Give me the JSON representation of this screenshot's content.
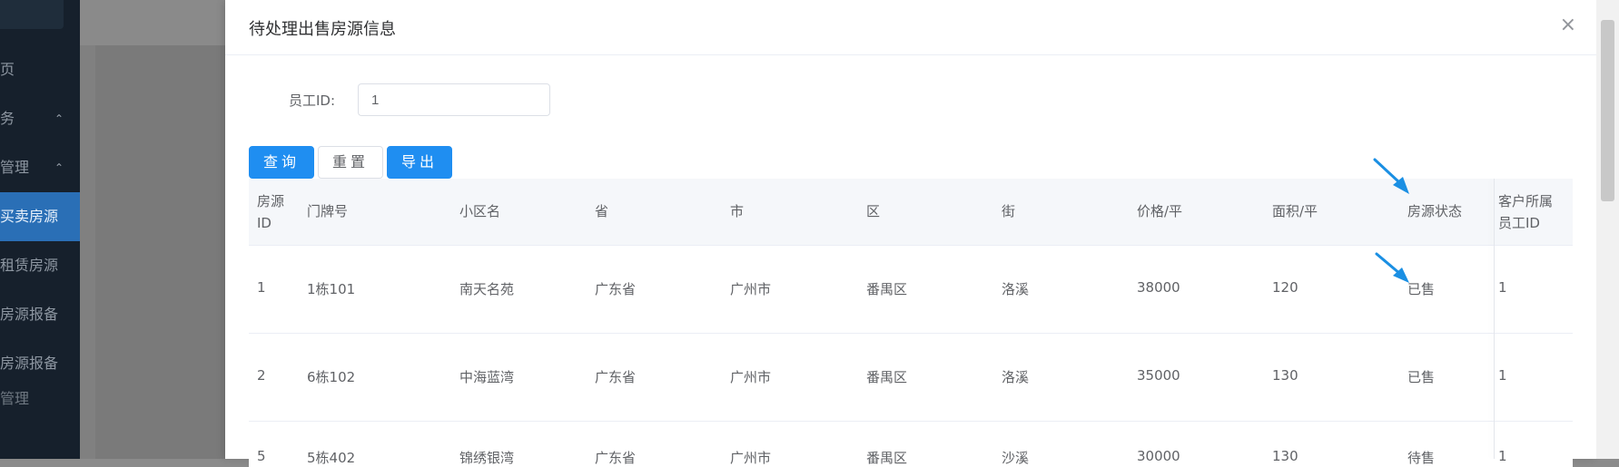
{
  "sidebar": {
    "items": [
      {
        "label": "页",
        "chevron": ""
      },
      {
        "label": "务",
        "chevron": "⌃"
      },
      {
        "label": "管理",
        "chevron": "⌃"
      },
      {
        "label": "买卖房源",
        "chevron": "",
        "active": true
      },
      {
        "label": "租赁房源",
        "chevron": ""
      },
      {
        "label": "房源报备",
        "chevron": ""
      },
      {
        "label": "房源报备",
        "chevron": ""
      },
      {
        "label": "管理",
        "chevron": ""
      }
    ]
  },
  "dialog": {
    "title": "待处理出售房源信息",
    "close_label": "×"
  },
  "form": {
    "employee_label": "员工ID:",
    "employee_value": "1"
  },
  "buttons": {
    "query": "查询",
    "reset": "重置",
    "export": "导出"
  },
  "table": {
    "headers": [
      "房源ID",
      "门牌号",
      "小区名",
      "省",
      "市",
      "区",
      "街",
      "价格/平",
      "面积/平",
      "房源状态",
      "客户所属员工ID"
    ],
    "header_lines": {
      "id_1": "房源",
      "id_2": "ID",
      "owner_1": "客户所属",
      "owner_2": "员工ID"
    },
    "rows": [
      {
        "id": "1",
        "door": "1栋101",
        "community": "南天名苑",
        "province": "广东省",
        "city": "广州市",
        "district": "番禺区",
        "street": "洛溪",
        "price": "38000",
        "area": "120",
        "status": "已售",
        "employee": "1"
      },
      {
        "id": "2",
        "door": "6栋102",
        "community": "中海蓝湾",
        "province": "广东省",
        "city": "广州市",
        "district": "番禺区",
        "street": "洛溪",
        "price": "35000",
        "area": "130",
        "status": "已售",
        "employee": "1"
      },
      {
        "id": "5",
        "door": "5栋402",
        "community": "锦绣银湾",
        "province": "广东省",
        "city": "广州市",
        "district": "番禺区",
        "street": "沙溪",
        "price": "30000",
        "area": "130",
        "status": "待售",
        "employee": "1"
      }
    ]
  },
  "colors": {
    "primary": "#1f8ef1",
    "annotation_arrow": "#1a8fe3"
  }
}
